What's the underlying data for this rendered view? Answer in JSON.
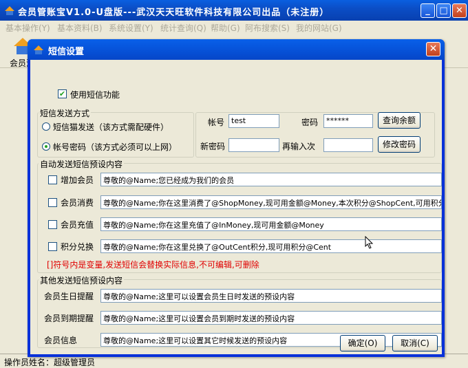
{
  "main_window": {
    "title": "会员管账宝V1.0-U盘版---武汉天天旺软件科技有限公司出品（未注册）",
    "controls": {
      "minimize": "_",
      "maximize": "□",
      "close": "✕"
    }
  },
  "menubar": {
    "items": [
      "基本操作(Y)",
      "基本资料(B)",
      "系统设置(Y)",
      "统计查询(Q)",
      "帮助(G)",
      "阿布搜索(S)",
      "我的网站(G)"
    ]
  },
  "toolbar": {
    "items": [
      {
        "label": "会员消",
        "icon": "member-consume-icon"
      }
    ]
  },
  "statusbar": {
    "operator": "操作员姓名：超级管理员"
  },
  "dialog": {
    "title": "短信设置",
    "close_label": "✕",
    "enable_sms": {
      "label": "使用短信功能",
      "checked": true
    },
    "send_mode": {
      "group_title": "短信发送方式",
      "options": [
        {
          "label": "短信猫发送（该方式需配硬件）",
          "checked": false
        },
        {
          "label": "帐号密码（该方式必须可以上网）",
          "checked": true
        }
      ]
    },
    "account": {
      "account_label": "帐号",
      "account_value": "test",
      "password_label": "密码",
      "password_value": "******",
      "query_balance_button": "查询余额",
      "new_password_label": "新密码",
      "new_password_value": "",
      "reenter_label": "再输入次",
      "reenter_value": "",
      "change_password_button": "修改密码"
    },
    "auto_send": {
      "group_title": "自动发送短信预设内容",
      "rows": [
        {
          "label": "增加会员",
          "checked": false,
          "text": "尊敬的@Name;您已经成为我们的会员"
        },
        {
          "label": "会员消费",
          "checked": false,
          "text": "尊敬的@Name;你在这里消费了@ShopMoney,现可用金额@Money,本次积分@ShopCent,可用积分@Ce"
        },
        {
          "label": "会员充值",
          "checked": false,
          "text": "尊敬的@Name;你在这里充值了@InMoney,现可用金额@Money"
        },
        {
          "label": "积分兑换",
          "checked": false,
          "text": "尊敬的@Name;你在这里兑换了@OutCent积分,现可用积分@Cent"
        }
      ],
      "note": "[]符号内是变量,发送短信会替换实际信息,不可编辑,可删除"
    },
    "other_send": {
      "group_title": "其他发送短信预设内容",
      "rows": [
        {
          "label": "会员生日提醒",
          "text": "尊敬的@Name;这里可以设置会员生日时发送的预设内容"
        },
        {
          "label": "会员到期提醒",
          "text": "尊敬的@Name;这里可以设置会员到期时发送的预设内容"
        },
        {
          "label": "会员信息",
          "text": "尊敬的@Name;这里可以设置其它时候发送的预设内容"
        }
      ]
    },
    "ok_button": "确定(O)",
    "cancel_button": "取消(C)"
  }
}
